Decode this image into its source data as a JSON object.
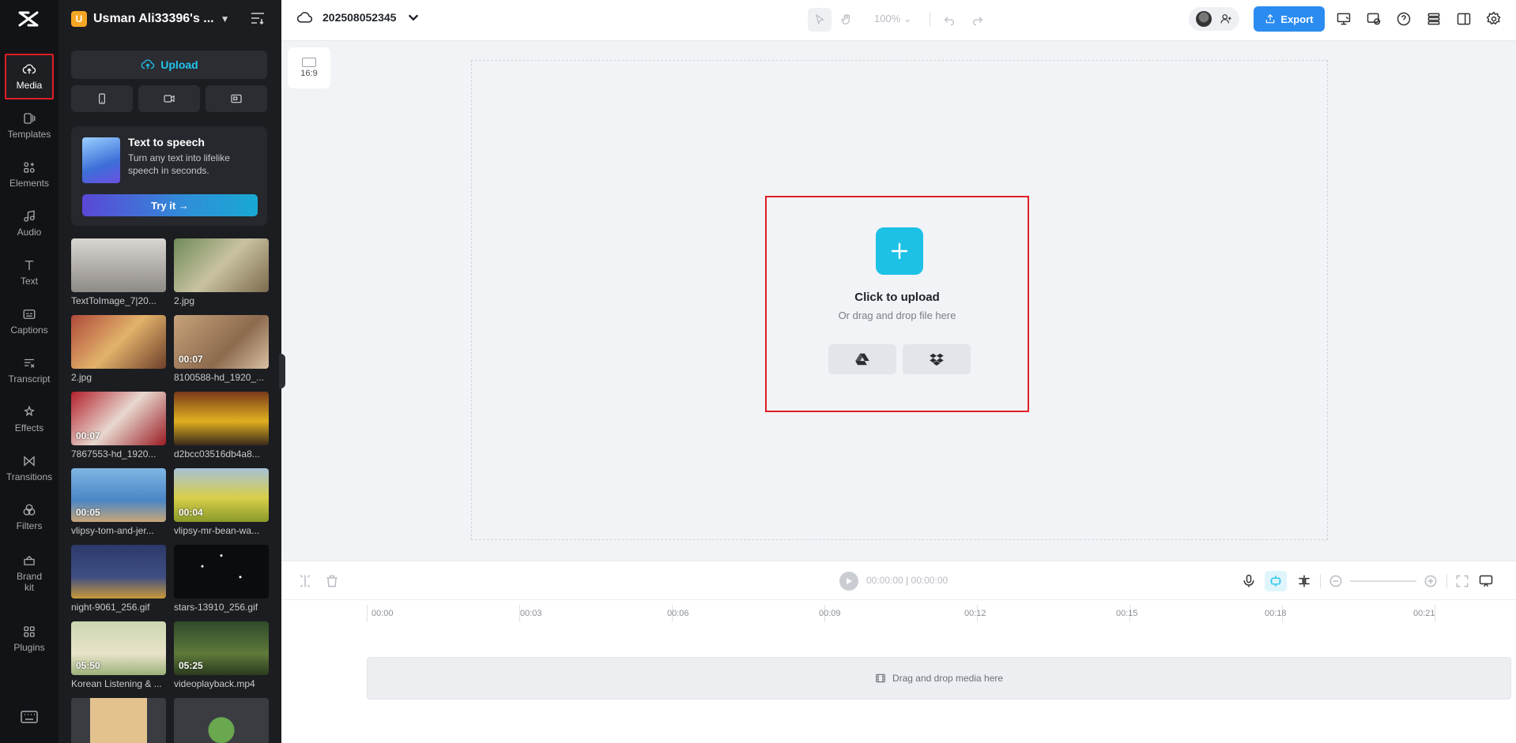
{
  "rail": {
    "items": [
      {
        "label": "Media",
        "icon": "cloud-upload-icon",
        "active": true
      },
      {
        "label": "Templates",
        "icon": "templates-icon"
      },
      {
        "label": "Elements",
        "icon": "elements-icon"
      },
      {
        "label": "Audio",
        "icon": "music-note-icon"
      },
      {
        "label": "Text",
        "icon": "text-icon"
      },
      {
        "label": "Captions",
        "icon": "captions-icon"
      },
      {
        "label": "Transcript",
        "icon": "transcript-icon"
      },
      {
        "label": "Effects",
        "icon": "effects-icon"
      },
      {
        "label": "Transitions",
        "icon": "transitions-icon"
      },
      {
        "label": "Filters",
        "icon": "filters-icon"
      },
      {
        "label": "Brand kit",
        "icon": "brand-kit-icon"
      },
      {
        "label": "Plugins",
        "icon": "plugins-icon"
      }
    ]
  },
  "panel": {
    "workspace_initial": "U",
    "workspace_name": "Usman Ali33396's ...",
    "upload_label": "Upload",
    "tts": {
      "title": "Text to speech",
      "description": "Turn any text into lifelike speech in seconds.",
      "button": "Try it →"
    },
    "media": [
      {
        "name": "TextToImage_7|20...",
        "duration": ""
      },
      {
        "name": "2.jpg",
        "duration": ""
      },
      {
        "name": "2.jpg",
        "duration": ""
      },
      {
        "name": "8100588-hd_1920_...",
        "duration": "00:07"
      },
      {
        "name": "7867553-hd_1920...",
        "duration": "00:07"
      },
      {
        "name": "d2bcc03516db4a8...",
        "duration": ""
      },
      {
        "name": "vlipsy-tom-and-jer...",
        "duration": "00:05"
      },
      {
        "name": "vlipsy-mr-bean-wa...",
        "duration": "00:04"
      },
      {
        "name": "night-9061_256.gif",
        "duration": ""
      },
      {
        "name": "stars-13910_256.gif",
        "duration": ""
      },
      {
        "name": "Korean Listening & ...",
        "duration": "05:50"
      },
      {
        "name": "videoplayback.mp4",
        "duration": "05:25"
      },
      {
        "name": "",
        "duration": ""
      },
      {
        "name": "",
        "duration": ""
      }
    ]
  },
  "topbar": {
    "project_name": "202508052345",
    "zoom": "100%",
    "export_label": "Export"
  },
  "canvas": {
    "ratio": "16:9",
    "upload_title": "Click to upload",
    "upload_sub": "Or drag and drop file here"
  },
  "timeline": {
    "current_time": "00:00:00",
    "total_time": "00:00:00",
    "ruler": [
      "00:00",
      "00:03",
      "00:06",
      "00:09",
      "00:12",
      "00:15",
      "00:18",
      "00:21"
    ],
    "track_hint": "Drag and drop media here"
  },
  "colors": {
    "accent": "#22c3ee",
    "export": "#2a8cf0",
    "highlight": "#e11d24"
  }
}
